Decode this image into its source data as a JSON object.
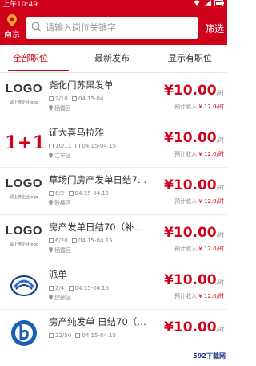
{
  "statusbar": {
    "time": "上午10:49"
  },
  "header": {
    "city": "南京",
    "filter_label": "筛选"
  },
  "search": {
    "placeholder": "请输入岗位关键字"
  },
  "tabs": [
    {
      "label": "全部职位"
    },
    {
      "label": "最新发布"
    },
    {
      "label": "显示有职位"
    }
  ],
  "list": [
    {
      "logo_text": "LOGO",
      "logo_sub": "请上传企业logo",
      "title": "尧化门苏果发单",
      "count": "2/10",
      "date": "04.15-04",
      "district": "栖霞区",
      "price": "¥10.00",
      "unit": "/时",
      "est_label": "预计收入",
      "est_value": "¥ 12.0/时"
    },
    {
      "logo_text": "1+1",
      "logo_sub": "",
      "title": "证大喜马拉雅",
      "count": "10/11",
      "date": "04.15-04.15",
      "district": "江宁区",
      "price": "¥10.00",
      "unit": "/时",
      "est_label": "预计收入",
      "est_value": "¥ 12.0/时"
    },
    {
      "logo_text": "LOGO",
      "logo_sub": "请上传企业logo",
      "title": "草场门房产发单日结7…",
      "count": "6/2",
      "date": "04.15-04.15",
      "district": "鼓楼区",
      "price": "¥10.00",
      "unit": "/时",
      "est_label": "预计收入",
      "est_value": "¥ 12.0/时"
    },
    {
      "logo_text": "LOGO",
      "logo_sub": "请上传企业logo",
      "title": "房产发单日结70（补…",
      "count": "6/20",
      "date": "04.15-04.15",
      "district": "栖霞区",
      "price": "¥10.00",
      "unit": "/时",
      "est_label": "预计收入",
      "est_value": "¥ 12.0/时"
    },
    {
      "logo_text": "",
      "logo_sub": "",
      "title": "派单",
      "count": "2/4",
      "date": "04.15-04.15",
      "district": "建邺区",
      "price": "¥10.00",
      "unit": "/时",
      "est_label": "预计收入",
      "est_value": "¥ 12.0/时"
    },
    {
      "logo_text": "",
      "logo_sub": "",
      "title": "房产纯发单 日结70（…",
      "count": "22/50",
      "date": "04.15-04.15",
      "district": "",
      "price": "¥10.00",
      "unit": "/时",
      "est_label": "",
      "est_value": ""
    }
  ],
  "watermark": "592下载网"
}
